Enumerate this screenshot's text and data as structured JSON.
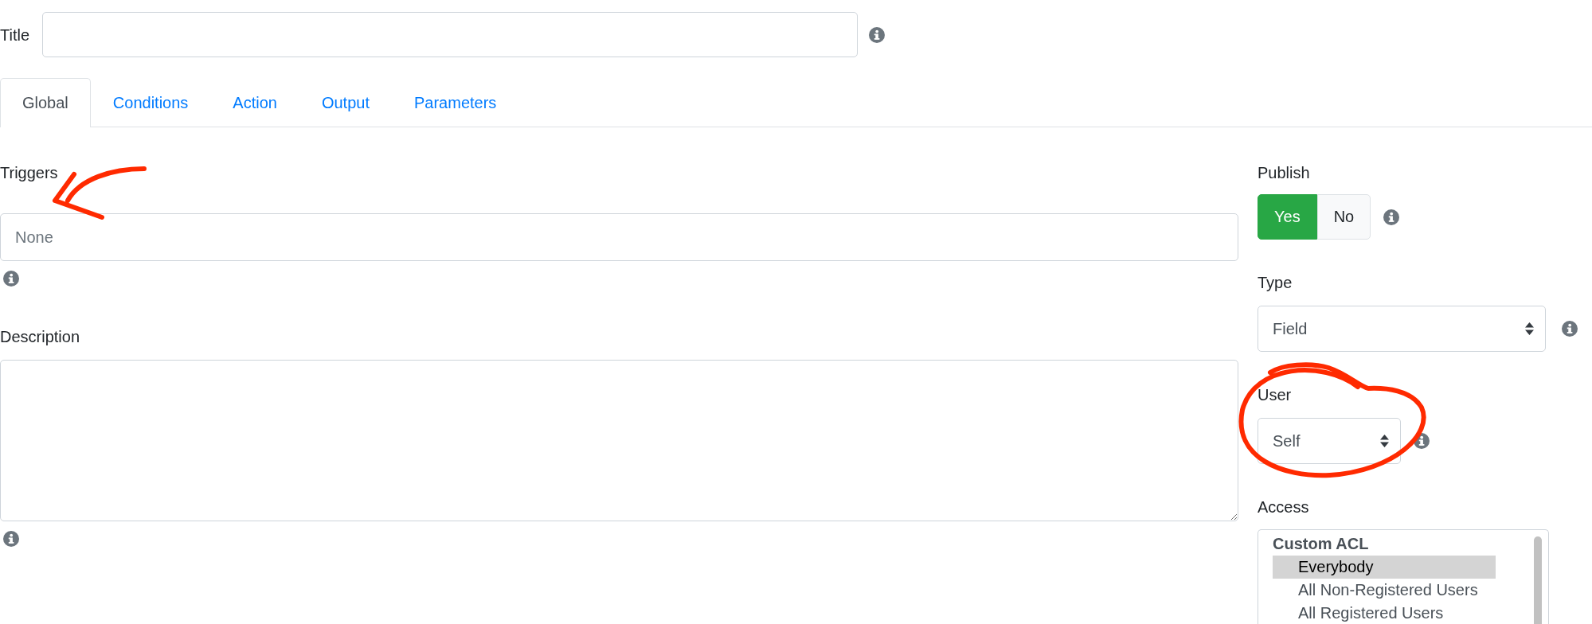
{
  "title": {
    "label": "Title"
  },
  "tabs": [
    {
      "label": "Global",
      "selected": true
    },
    {
      "label": "Conditions",
      "selected": false
    },
    {
      "label": "Action",
      "selected": false
    },
    {
      "label": "Output",
      "selected": false
    },
    {
      "label": "Parameters",
      "selected": false
    }
  ],
  "triggers": {
    "label": "Triggers",
    "placeholder": "None"
  },
  "description": {
    "label": "Description"
  },
  "publish": {
    "label": "Publish",
    "options": [
      {
        "label": "Yes",
        "selected": true
      },
      {
        "label": "No",
        "selected": false
      }
    ]
  },
  "type": {
    "label": "Type",
    "value": "Field"
  },
  "user": {
    "label": "User",
    "value": "Self"
  },
  "access": {
    "label": "Access",
    "groups": [
      {
        "label": "Custom ACL",
        "items": [
          {
            "label": "Everybody",
            "selected": true
          },
          {
            "label": "All Non-Registered Users",
            "selected": false
          },
          {
            "label": "All Registered Users",
            "selected": false
          }
        ]
      }
    ]
  }
}
